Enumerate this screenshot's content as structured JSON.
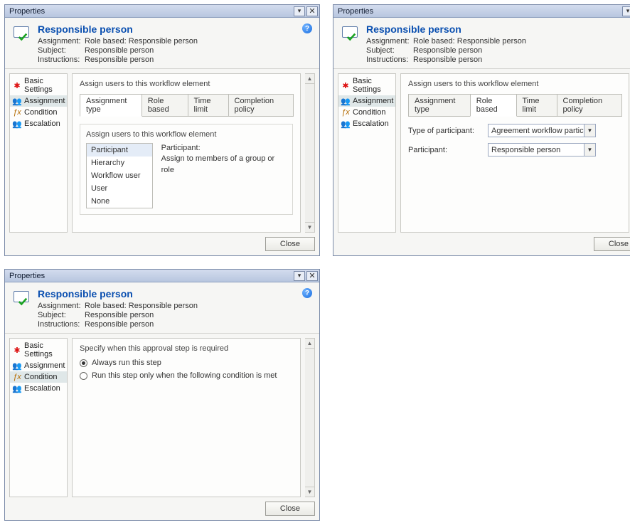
{
  "common": {
    "window_title": "Properties",
    "page_title": "Responsible person",
    "meta": {
      "assignment_label": "Assignment:",
      "assignment_value": "Role based: Responsible person",
      "subject_label": "Subject:",
      "subject_value": "Responsible person",
      "instructions_label": "Instructions:",
      "instructions_value": "Responsible person"
    },
    "sidebar": {
      "basic": "Basic Settings",
      "assignment": "Assignment",
      "condition": "Condition",
      "escalation": "Escalation"
    },
    "tabs": {
      "assignment_type": "Assignment type",
      "role_based": "Role based",
      "time_limit": "Time limit",
      "completion_policy": "Completion policy"
    },
    "close": "Close"
  },
  "panel1": {
    "content_heading": "Assign users to this workflow element",
    "inner_heading": "Assign users to this workflow element",
    "list": {
      "participant": "Participant",
      "hierarchy": "Hierarchy",
      "workflow_user": "Workflow user",
      "user": "User",
      "none": "None"
    },
    "desc_title": "Participant:",
    "desc_body": "Assign to members of a group or role"
  },
  "panel2": {
    "content_heading": "Assign users to this workflow element",
    "type_label": "Type of participant:",
    "type_value": "Agreement workflow particip",
    "part_label": "Participant:",
    "part_value": "Responsible person"
  },
  "panel3": {
    "content_heading": "Specify when this approval step is required",
    "opt_always": "Always run this step",
    "opt_cond": "Run this step only when the following condition is met"
  }
}
